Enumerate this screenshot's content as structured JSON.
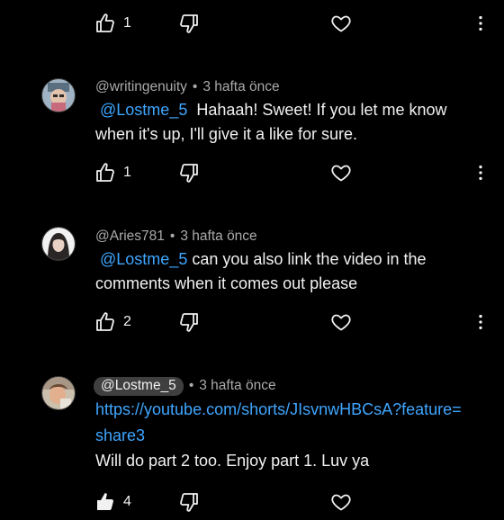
{
  "top_actions": {
    "like_count": "1"
  },
  "comments": [
    {
      "author": "@writingenuity",
      "time": "3 hafta önce",
      "mention": "@Lostme_5",
      "text_line1": "Hahaah!  Sweet!  If you let me know",
      "text_line2": "when it's up, I'll give it a like for sure.",
      "like_count": "1"
    },
    {
      "author": "@Aries781",
      "time": "3 hafta önce",
      "mention": "@Lostme_5",
      "text_line1": "can you also link the video in the",
      "text_line2": "comments when it comes out please",
      "like_count": "2"
    },
    {
      "author": "@Lostme_5",
      "time": "3 hafta önce",
      "link_line1": "https://youtube.com/shorts/JIsvnwHBCsA?feature=",
      "link_line2": "share3",
      "text_line3": "Will do part 2 too. Enjoy part 1. Luv ya",
      "like_count": "4"
    }
  ],
  "colors": {
    "background": "#000000",
    "text": "#f1f1f1",
    "secondary_text": "#aaaaaa",
    "link": "#3ea6ff",
    "chip": "#3f3f3f"
  },
  "icons": [
    "thumb-up-icon",
    "thumb-down-icon",
    "heart-icon",
    "more-vertical-icon"
  ]
}
